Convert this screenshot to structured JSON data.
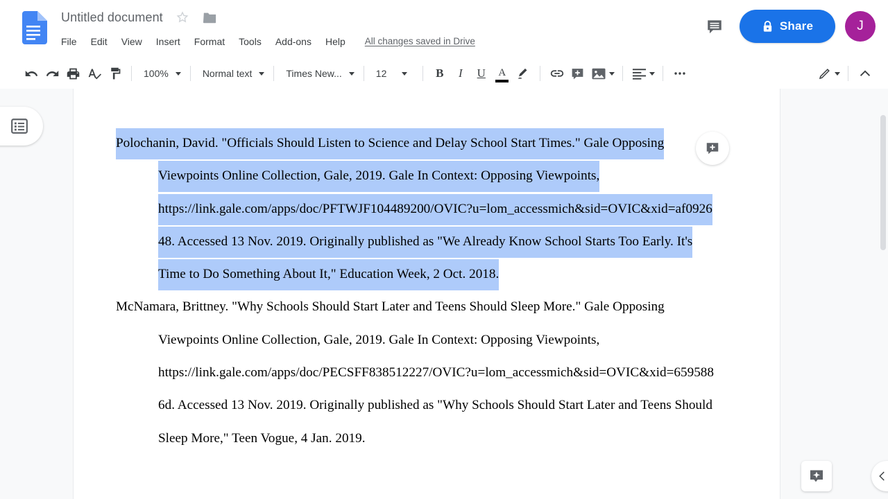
{
  "app": {
    "name": "Google Docs",
    "logo_icon": "docs-file-icon"
  },
  "header": {
    "doc_title": "Untitled document",
    "star_icon": "star-outline-icon",
    "folder_icon": "folder-icon",
    "menus": [
      "File",
      "Edit",
      "View",
      "Insert",
      "Format",
      "Tools",
      "Add-ons",
      "Help"
    ],
    "save_status": "All changes saved in Drive",
    "comment_icon": "comment-history-icon",
    "share": {
      "label": "Share",
      "lock_icon": "lock-icon",
      "color": "#1a73e8"
    },
    "avatar": {
      "initial": "J",
      "color": "#a5219a"
    }
  },
  "toolbar": {
    "undo_icon": "undo-icon",
    "redo_icon": "redo-icon",
    "print_icon": "print-icon",
    "spellcheck_icon": "spellcheck-icon",
    "paint_format_icon": "paint-format-icon",
    "zoom_value": "100%",
    "style_value": "Normal text",
    "font_value": "Times New...",
    "font_size_value": "12",
    "bold_label": "B",
    "italic_label": "I",
    "underline_label": "U",
    "text_color_label": "A",
    "text_color_swatch": "#000000",
    "highlight_icon": "highlight-pen-icon",
    "link_icon": "insert-link-icon",
    "comment_icon": "add-comment-icon",
    "image_icon": "insert-image-icon",
    "align_icon": "align-left-icon",
    "more_icon": "more-options-icon",
    "editing_mode_icon": "edit-pencil-icon",
    "hide_menus_icon": "chevron-up-icon"
  },
  "floating": {
    "outline_icon": "document-outline-icon",
    "add_comment_icon": "add-comment-bubble-icon",
    "explore_icon": "explore-sparkle-icon",
    "collapse_icon": "chevron-left-icon",
    "scrollbar": "vertical-scrollbar"
  },
  "document": {
    "selection_color": "#aecbfa",
    "paragraphs": [
      {
        "selected": true,
        "lines": [
          {
            "indent": false,
            "text": "Polochanin, David. \"Officials Should Listen to Science and Delay School Start Times.\" Gale Opposing"
          },
          {
            "indent": true,
            "text": "Viewpoints Online Collection, Gale, 2019. Gale In Context: Opposing Viewpoints,"
          },
          {
            "indent": true,
            "text": "https://link.gale.com/apps/doc/PFTWJF104489200/OVIC?u=lom_accessmich&sid=OVIC&xid=af0926"
          },
          {
            "indent": true,
            "text": "48. Accessed 13 Nov. 2019. Originally published as \"We Already Know School Starts Too Early. It's"
          },
          {
            "indent": true,
            "text": "Time to Do Something About It,\" Education Week, 2 Oct. 2018."
          }
        ]
      },
      {
        "selected": false,
        "lines": [
          {
            "indent": false,
            "text": "McNamara, Brittney. \"Why Schools Should Start Later and Teens Should Sleep More.\" Gale Opposing"
          },
          {
            "indent": true,
            "text": "Viewpoints Online Collection, Gale, 2019. Gale In Context: Opposing Viewpoints,"
          },
          {
            "indent": true,
            "text": "https://link.gale.com/apps/doc/PECSFF838512227/OVIC?u=lom_accessmich&sid=OVIC&xid=659588"
          },
          {
            "indent": true,
            "text": "6d. Accessed 13 Nov. 2019. Originally published as \"Why Schools Should Start Later and Teens Should"
          },
          {
            "indent": true,
            "text": "Sleep More,\" Teen Vogue, 4 Jan. 2019."
          }
        ]
      }
    ]
  }
}
